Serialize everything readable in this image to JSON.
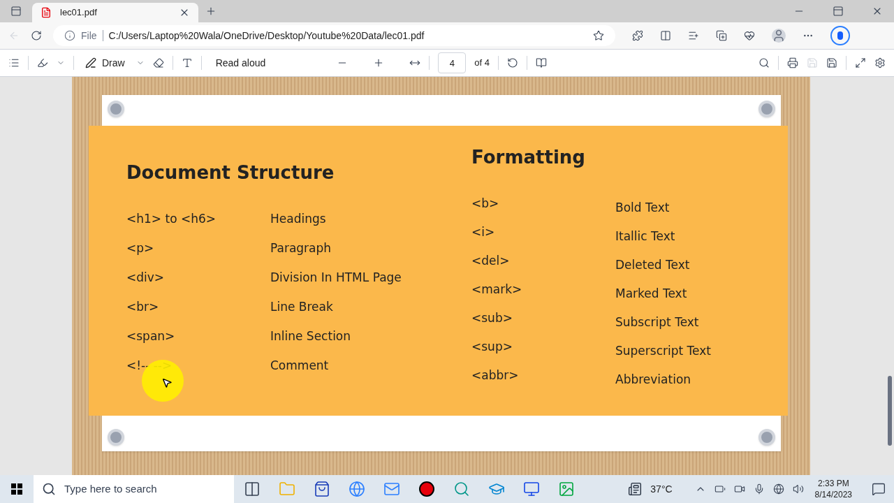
{
  "browser": {
    "tabs": [
      {
        "title": "lec01.pdf",
        "selected": true
      }
    ],
    "address": {
      "scheme": "File",
      "url": "C:/Users/Laptop%20Wala/OneDrive/Desktop/Youtube%20Data/lec01.pdf"
    }
  },
  "pdf_toolbar": {
    "draw": "Draw",
    "read_aloud": "Read aloud",
    "page": "4",
    "page_total": "of 4"
  },
  "slide": {
    "sections": [
      {
        "title": "Document Structure",
        "rows": [
          {
            "tag": "<h1> to <h6>",
            "desc": "Headings"
          },
          {
            "tag": "<p>",
            "desc": "Paragraph"
          },
          {
            "tag": "<div>",
            "desc": "Division In HTML Page"
          },
          {
            "tag": "<br>",
            "desc": "Line Break"
          },
          {
            "tag": "<span>",
            "desc": "Inline Section"
          },
          {
            "tag": "<!-- -->",
            "desc": "Comment"
          }
        ]
      },
      {
        "title": "Formatting",
        "rows": [
          {
            "tag": "<b>",
            "desc": "Bold Text"
          },
          {
            "tag": "<i>",
            "desc": "Itallic Text"
          },
          {
            "tag": "<del>",
            "desc": "Deleted Text"
          },
          {
            "tag": "<mark>",
            "desc": "Marked Text"
          },
          {
            "tag": "<sub>",
            "desc": "Subscript Text"
          },
          {
            "tag": "<sup>",
            "desc": "Superscript Text"
          },
          {
            "tag": "<abbr>",
            "desc": "Abbreviation"
          }
        ]
      }
    ]
  },
  "taskbar": {
    "search_placeholder": "Type here to search",
    "weather": "37°C",
    "time": "2:33 PM",
    "date": "8/14/2023"
  }
}
